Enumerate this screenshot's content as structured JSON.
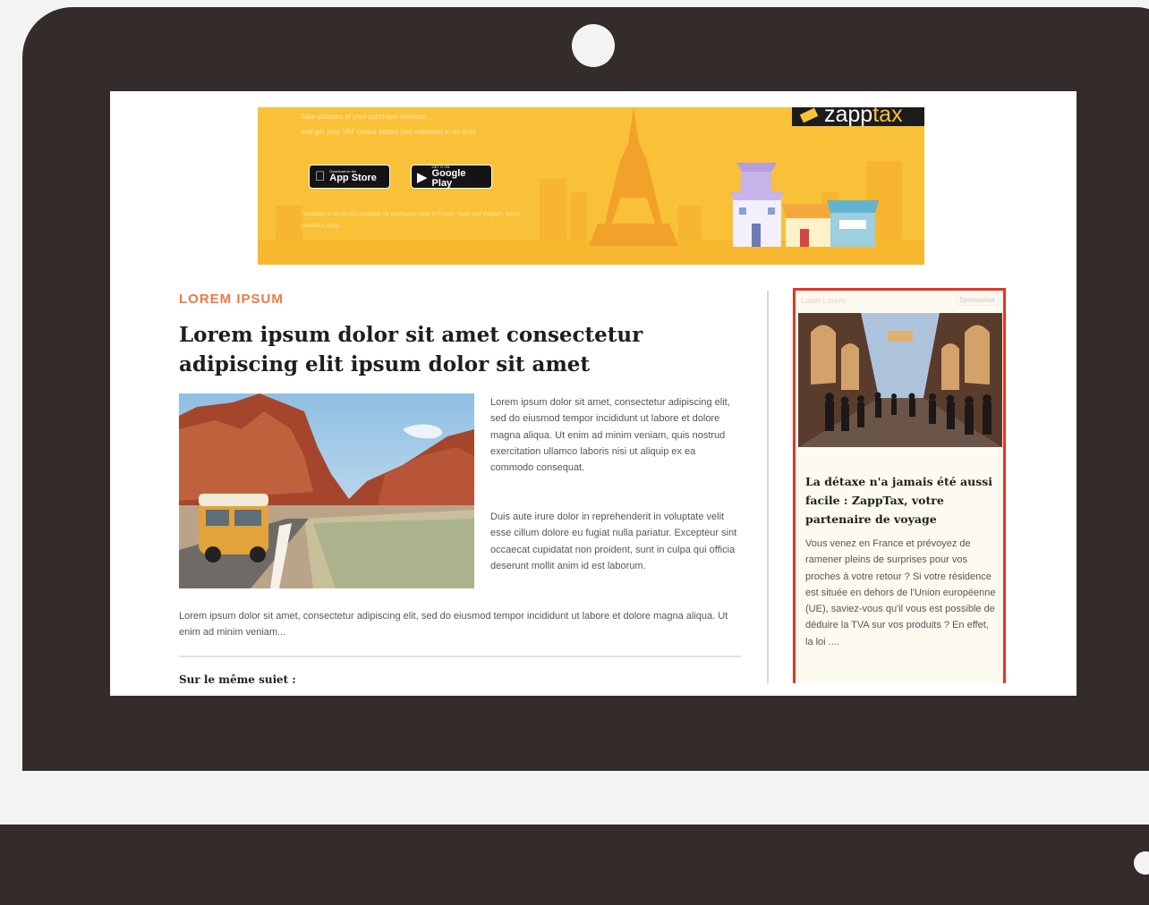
{
  "banner": {
    "line1": "Take pictures of your purchase invoices",
    "line2": "and get your VAT (value added tax) refunded in no time",
    "app_store_small": "Download on the",
    "app_store_big": "App Store",
    "google_play_small": "GET IT ON",
    "google_play_big": "Google Play",
    "footnote": "* Available to all non-EU residents for purchases made in France, Spain and Belgium. Some conditions apply.",
    "brand_part1": "zapp",
    "brand_part2": "tax"
  },
  "article": {
    "category": "LOREM IPSUM",
    "title": "Lorem ipsum dolor sit amet consectetur adipiscing elit ipsum dolor sit amet",
    "para1": "Lorem ipsum dolor sit amet, consectetur adipiscing elit, sed do eiusmod tempor incididunt ut labore et dolore magna aliqua. Ut enim ad minim veniam, quis nostrud exercitation ullamco laboris nisi ut aliquip ex ea commodo consequat.",
    "para2": "Duis aute irure dolor in reprehenderit in voluptate velit esse cillum dolore eu fugiat nulla pariatur. Excepteur sint occaecat cupidatat non proident, sunt in culpa qui officia deserunt mollit anim id est laborum.",
    "para3": "Lorem ipsum dolor sit amet, consectetur adipiscing elit, sed do eiusmod tempor incididunt ut labore et dolore magna aliqua. Ut enim ad minim veniam...",
    "related": "Sur le même sujet :"
  },
  "sponsored": {
    "label": "Label Lorem",
    "badge": "Sponsorisé",
    "title": "La détaxe n'a jamais été aussi facile : ZappTax, votre partenaire de voyage",
    "body": "Vous venez en France et prévoyez de ramener pleins de surprises pour vos proches à votre retour ? Si votre résidence est située en dehors de l'Union européenne (UE), saviez-vous qu'il vous est possible de déduire la TVA sur vos produits ? En effet, la loi ...."
  },
  "colors": {
    "laptop": "#332c2a",
    "banner": "#f9c137",
    "category": "#ea7a45",
    "sponsor_border": "#e53523"
  },
  "icons": [
    "apple-icon",
    "google-play-icon",
    "webcam",
    "price-tag-icon"
  ]
}
